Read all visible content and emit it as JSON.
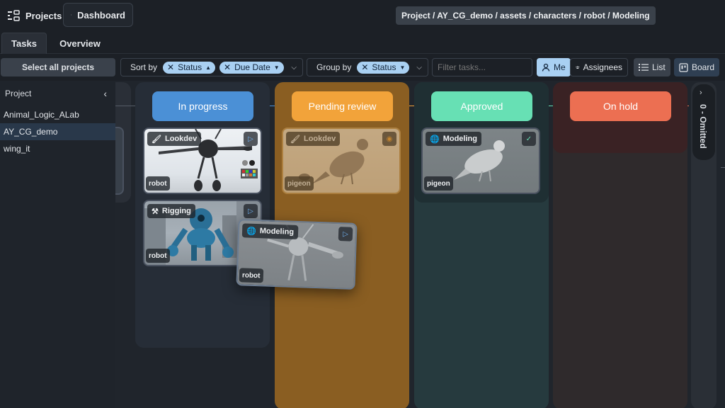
{
  "topbar": {
    "projects_label": "Projects",
    "dashboard_label": "Dashboard",
    "breadcrumb": "Project / AY_CG_demo / assets / characters / robot / Modeling"
  },
  "tabs": [
    {
      "label": "Tasks",
      "active": true
    },
    {
      "label": "Overview",
      "active": false
    }
  ],
  "toolbar": {
    "select_all_label": "Select all projects",
    "sort_label": "Sort by",
    "sort_chips": [
      "Status",
      "Due Date"
    ],
    "group_label": "Group by",
    "group_chip": "Status",
    "filter_placeholder": "Filter tasks...",
    "me_label": "Me",
    "assignees_label": "Assignees",
    "list_label": "List",
    "board_label": "Board"
  },
  "sidebar": {
    "header": "Project",
    "items": [
      "Animal_Logic_ALab",
      "AY_CG_demo",
      "wing_it"
    ],
    "selected": "AY_CG_demo"
  },
  "board": {
    "columns": [
      {
        "label": "In progress",
        "color": "#4b90d6"
      },
      {
        "label": "Pending review",
        "color": "#f2a33a"
      },
      {
        "label": "Approved",
        "color": "#67e0b4"
      },
      {
        "label": "On hold",
        "color": "#ec6f52"
      }
    ],
    "omitted_label": "0 - Omitted",
    "cards": [
      {
        "task": "Lookdev",
        "entity": "robot",
        "icon": "paintbrush-icon",
        "status_icon": "play-icon"
      },
      {
        "task": "Rigging",
        "entity": "robot",
        "icon": "tools-icon",
        "status_icon": "play-icon"
      },
      {
        "task": "Modeling",
        "entity": "robot",
        "icon": "globe-icon",
        "status_icon": "play-icon"
      },
      {
        "task": "Lookdev",
        "entity": "pigeon",
        "icon": "paintbrush-icon",
        "status_icon": "eye-icon"
      },
      {
        "task": "Modeling",
        "entity": "pigeon",
        "icon": "globe-icon",
        "status_icon": "check-icon"
      }
    ]
  }
}
